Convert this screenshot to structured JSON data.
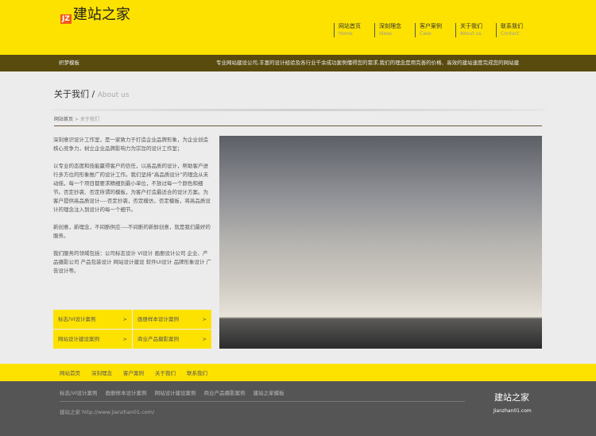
{
  "header": {
    "logo_badge": "JZ",
    "logo_text": "建站之家",
    "nav": [
      {
        "cn": "网站首页",
        "en": "Home"
      },
      {
        "cn": "深刻理念",
        "en": "Ideas"
      },
      {
        "cn": "客户案例",
        "en": "Case"
      },
      {
        "cn": "关于我们",
        "en": "About us"
      },
      {
        "cn": "联系我们",
        "en": "Contact"
      }
    ]
  },
  "bar": {
    "left": "织梦模板",
    "right": "专业网站建设公司,丰富的设计经验及各行业千余成功案例懂得您的需求,我们的理念是用完善的价格、高效的建站速度完成您的网站建"
  },
  "page": {
    "title": "关于我们",
    "title_sep": " / ",
    "title_en": "About us",
    "breadcrumb_home": "网站首页",
    "breadcrumb_sep": " > ",
    "breadcrumb_current": "关于我们"
  },
  "content": {
    "paragraphs": [
      "深刻意识设计工作室，是一家致力于打造企业品牌形象，为企业创造核心竞争力，树立企业品牌影响力为宗旨的设计工作室；",
      "以专业的态度和技能赢得客户的信任，以高品质的设计，帮助客户进行多方位的形象推广的设计工作。我们坚持“高品质设计”的理念从未动摇，每一个项目都要求精细到最小单位，不放过每一个颜色和细节。否定抄袭、否定所谓的模板，为客户打造最适合的设计方案。为客户提供高品质设计----否定抄袭，否定模仿，否定模板，将高品质设计的理念注入到设计的每一个细节。",
      "新创意，新理念，不间断供应----不间断的新鲜创意，就是我们最好的服务。",
      "我们服务的领域包括：公司标志设计 VI设计 画册设计公司 企业、产品摄影公司 产品包装设计 网站设计建设 软件UI设计 品牌形象设计 广告设计等。"
    ]
  },
  "cases": [
    {
      "label": "标志/VI设计案例",
      "arrow": ">"
    },
    {
      "label": "画册样本设计案例",
      "arrow": ">"
    },
    {
      "label": "网站设计建设案例",
      "arrow": ">"
    },
    {
      "label": "商业产品摄影案例",
      "arrow": ">"
    }
  ],
  "footer_nav": [
    "网站首页",
    "深刻理念",
    "客户案例",
    "关于我们",
    "联系我们"
  ],
  "footer": {
    "links": [
      "标志/VI设计案例",
      "画册样本设计案例",
      "网站设计建设案例",
      "商业产品摄影案例",
      "建站之家模板"
    ],
    "copyright": "建站之家 http://www.jianzhan01.com/",
    "brand": "建站之家",
    "domain": "Jianzhan01.com"
  }
}
